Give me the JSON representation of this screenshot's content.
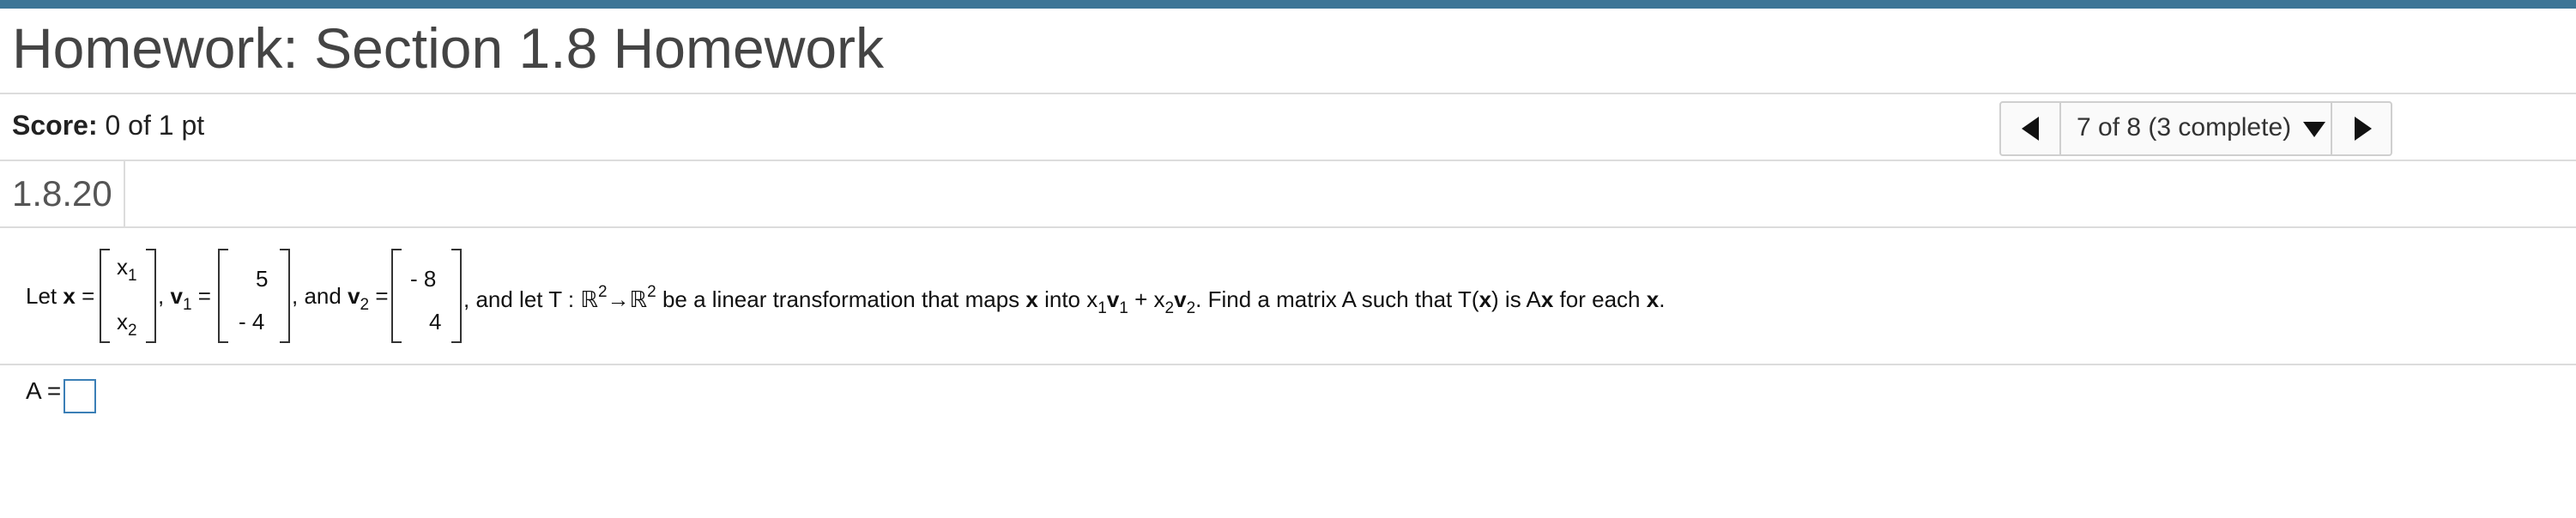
{
  "header": {
    "title": "Homework: Section 1.8 Homework"
  },
  "score": {
    "label": "Score:",
    "value": "0 of 1 pt"
  },
  "navigator": {
    "selected": "7 of 8 (3 complete)"
  },
  "question": {
    "number": "1.8.20"
  },
  "problem": {
    "let": "Let",
    "x": "x",
    "eq": "=",
    "x_entries": [
      [
        "x",
        "1"
      ],
      [
        "x",
        "2"
      ]
    ],
    "comma": ",",
    "v": "v",
    "v1_sub": "1",
    "v1_entries": [
      "5",
      "- 4"
    ],
    "and": ", and",
    "v2_sub": "2",
    "v2_entries": [
      "- 8",
      "4"
    ],
    "and_let_T": ", and let T :",
    "R": "ℝ",
    "R_sup": "2",
    "arrow": "→",
    "be_linear": "be a linear transformation that maps",
    "into": "into x",
    "plus": " + x",
    "find": ". Find a matrix A such that T(",
    "is": ") is A",
    "for_each": "for each",
    "end": "."
  },
  "answer": {
    "label": "A =",
    "value": ""
  },
  "colors": {
    "accent": "#3d7596",
    "input_border": "#3b7fb6",
    "divider": "#dcdcdc"
  },
  "icons": {
    "prev": "prev-arrow-icon",
    "next": "next-arrow-icon",
    "dropdown": "dropdown-caret-icon"
  }
}
